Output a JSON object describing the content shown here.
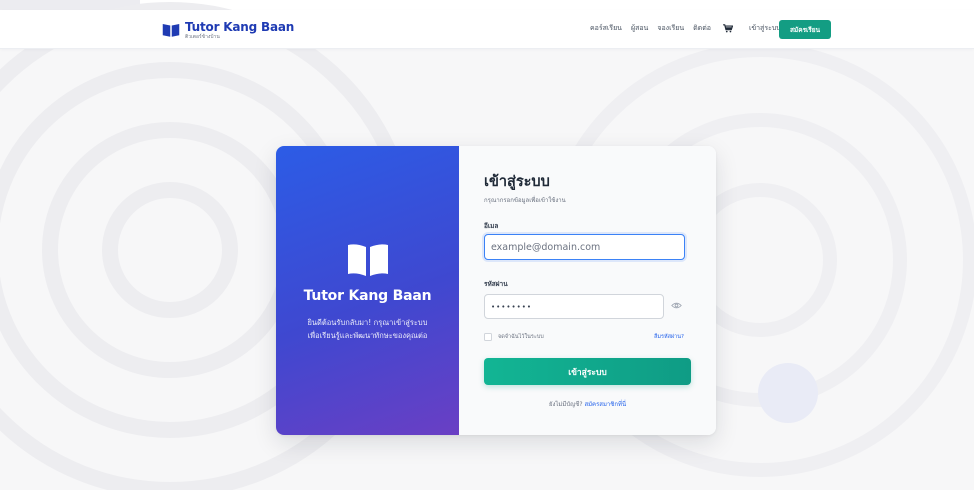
{
  "header": {
    "logo_title": "Tutor Kang Baan",
    "logo_subtitle": "ติวเตอร์ข้างบ้าน",
    "nav": {
      "courses": "คอร์สเรียน",
      "tutors": "ผู้สอน",
      "booking": "จองเรียน",
      "contact": "ติดต่อ"
    },
    "cart_icon": "cart-icon",
    "login_label": "เข้าสู่ระบบ",
    "register_label": "สมัครเรียน"
  },
  "card": {
    "brand_title": "Tutor Kang Baan",
    "brand_desc_line1": "ยินดีต้อนรับกลับมา! กรุณาเข้าสู่ระบบ",
    "brand_desc_line2": "เพื่อเรียนรู้และพัฒนาทักษะของคุณต่อ",
    "title": "เข้าสู่ระบบ",
    "subtitle": "กรุณากรอกข้อมูลเพื่อเข้าใช้งาน",
    "email_label": "อีเมล",
    "email_placeholder": "example@domain.com",
    "email_value": "",
    "password_label": "รหัสผ่าน",
    "password_value": "••••••••",
    "remember_label": "จดจำฉันไว้ในระบบ",
    "forgot_label": "ลืมรหัสผ่าน?",
    "submit_label": "เข้าสู่ระบบ",
    "signup_prompt": "ยังไม่มีบัญชี?",
    "signup_link": "สมัครสมาชิกที่นี่"
  },
  "colors": {
    "primary_blue": "#2c5ce6",
    "gradient_purple": "#6a3fc4",
    "accent_green": "#139d83",
    "link_blue": "#2563eb"
  }
}
